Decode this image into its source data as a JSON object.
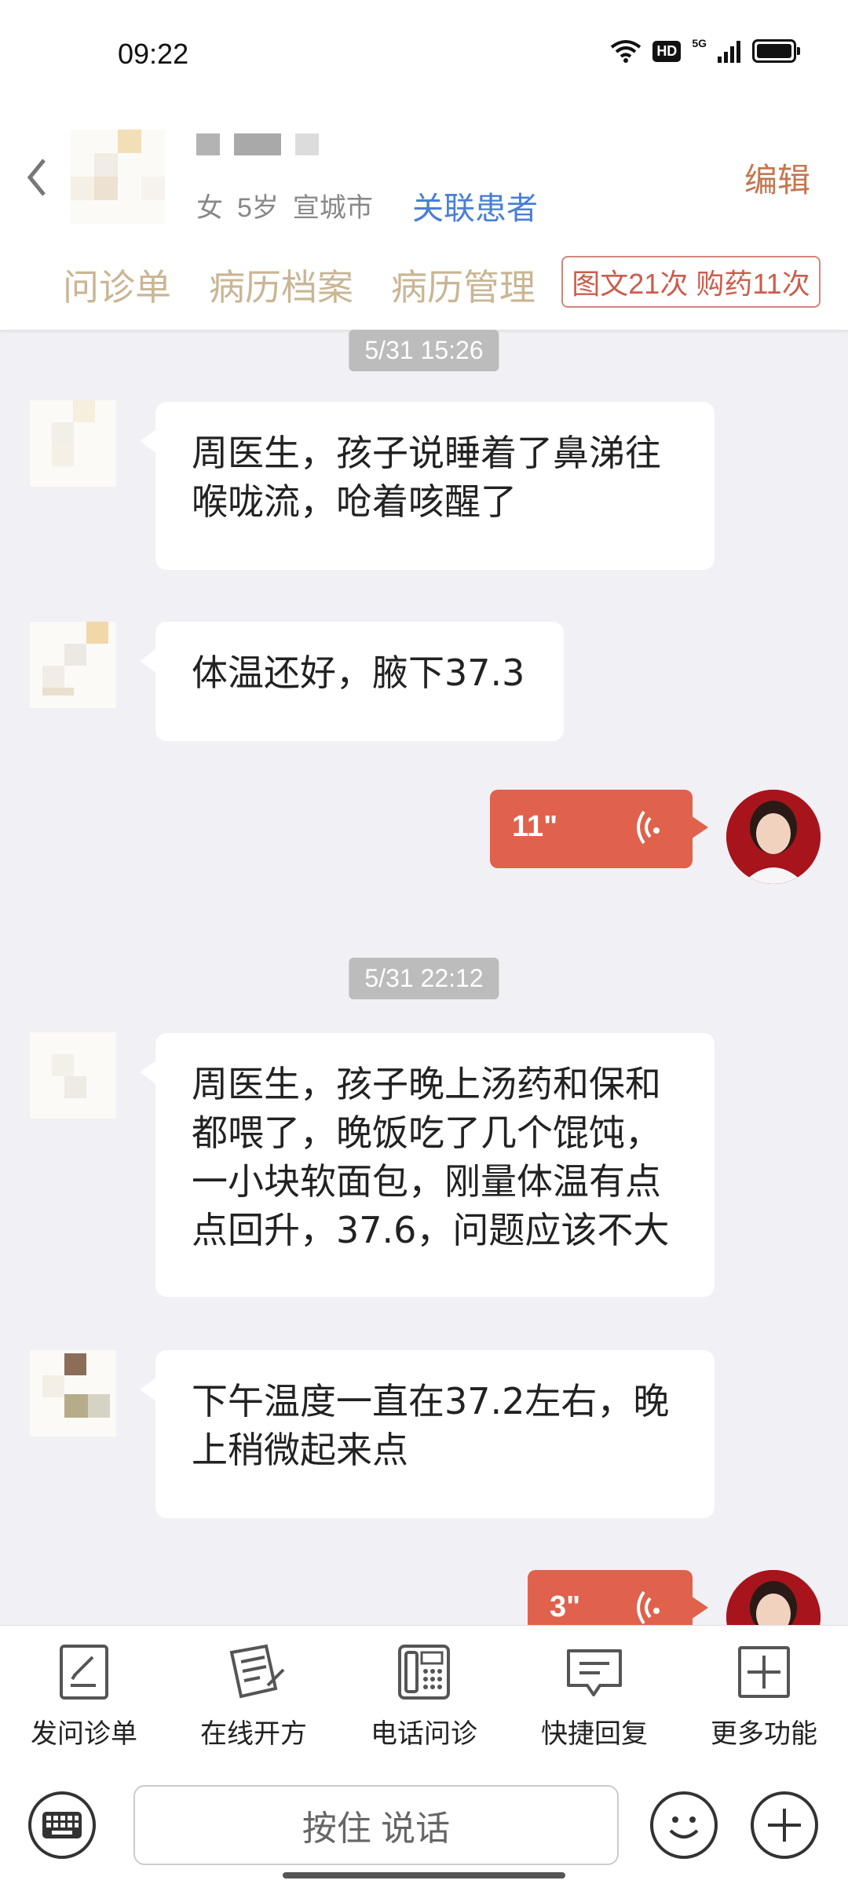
{
  "status_bar": {
    "time": "09:22",
    "network": "5G",
    "hd": "HD"
  },
  "header": {
    "patient_meta": {
      "gender": "女",
      "age": "5岁",
      "city": "宣城市"
    },
    "link_patient": "关联患者",
    "edit": "编辑",
    "tabs": [
      "问诊单",
      "病历档案",
      "病历管理"
    ],
    "count_badge": "图文21次 购药11次"
  },
  "chat": {
    "timestamp_1": "5/31 15:26",
    "msg_1": "周医生，孩子说睡着了鼻涕往喉咙流，呛着咳醒了",
    "msg_2": "体温还好，腋下37.3",
    "voice_1": "11\"",
    "timestamp_2": "5/31 22:12",
    "msg_3": "周医生，孩子晚上汤药和保和都喂了，晚饭吃了几个馄饨，一小块软面包，刚量体温有点点回升，37.6，问题应该不大",
    "msg_4": "下午温度一直在37.2左右，晚上稍微起来点",
    "voice_2": "3\""
  },
  "toolbar": {
    "items": [
      "发问诊单",
      "在线开方",
      "电话问诊",
      "快捷回复",
      "更多功能"
    ]
  },
  "input": {
    "hold_to_talk": "按住 说话"
  },
  "colors": {
    "accent_red": "#e0614c",
    "link_blue": "#4a7fd6",
    "tab_gold": "#c9b694",
    "edit_orange": "#c47650"
  }
}
